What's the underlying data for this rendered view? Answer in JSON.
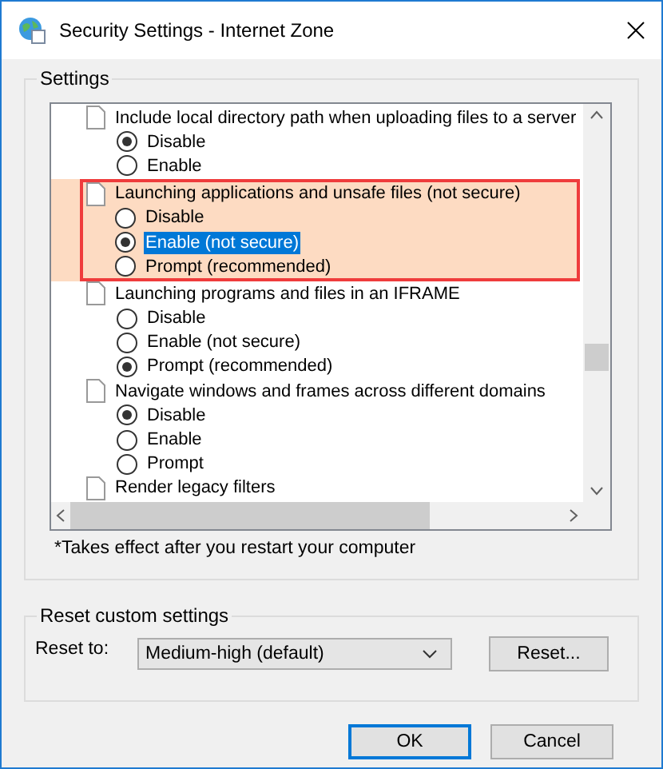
{
  "window": {
    "title": "Security Settings - Internet Zone"
  },
  "settings_group": {
    "title": "Settings",
    "items": [
      {
        "label": "Include local directory path when uploading files to a server",
        "highlighted": false,
        "options": [
          {
            "label": "Disable",
            "checked": true,
            "selected": false
          },
          {
            "label": "Enable",
            "checked": false,
            "selected": false
          }
        ]
      },
      {
        "label": "Launching applications and unsafe files (not secure)",
        "highlighted": true,
        "options": [
          {
            "label": "Disable",
            "checked": false,
            "selected": false
          },
          {
            "label": "Enable (not secure)",
            "checked": true,
            "selected": true
          },
          {
            "label": "Prompt (recommended)",
            "checked": false,
            "selected": false
          }
        ]
      },
      {
        "label": "Launching programs and files in an IFRAME",
        "highlighted": false,
        "options": [
          {
            "label": "Disable",
            "checked": false,
            "selected": false
          },
          {
            "label": "Enable (not secure)",
            "checked": false,
            "selected": false
          },
          {
            "label": "Prompt (recommended)",
            "checked": true,
            "selected": false
          }
        ]
      },
      {
        "label": "Navigate windows and frames across different domains",
        "highlighted": false,
        "options": [
          {
            "label": "Disable",
            "checked": true,
            "selected": false
          },
          {
            "label": "Enable",
            "checked": false,
            "selected": false
          },
          {
            "label": "Prompt",
            "checked": false,
            "selected": false
          }
        ]
      },
      {
        "label": "Render legacy filters",
        "highlighted": false
      }
    ],
    "note": "*Takes effect after you restart your computer"
  },
  "reset_group": {
    "title": "Reset custom settings",
    "label": "Reset to:",
    "dropdown": {
      "value": "Medium-high (default)"
    },
    "button": "Reset..."
  },
  "buttons": [
    {
      "label": "OK",
      "default": true
    },
    {
      "label": "Cancel",
      "default": false
    }
  ]
}
